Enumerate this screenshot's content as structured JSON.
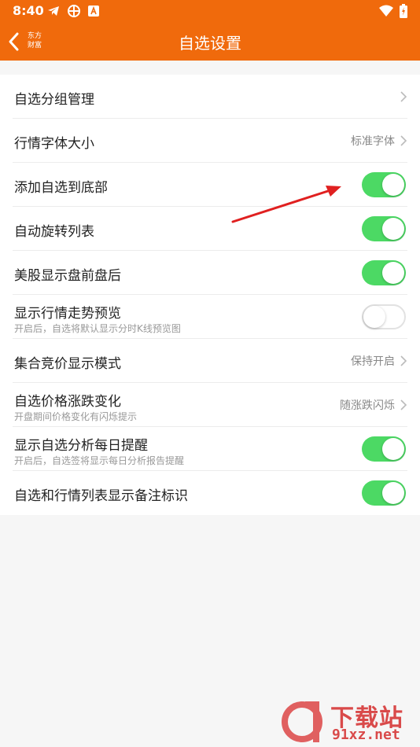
{
  "status_bar": {
    "time": "8:40",
    "left_icons": [
      "telegram-icon",
      "pinwheel-icon",
      "app-a-icon"
    ],
    "right_icons": [
      "wifi-icon",
      "battery-icon"
    ]
  },
  "header": {
    "title": "自选设置",
    "brand_line1": "东方",
    "brand_line2": "财富",
    "background": "#f06a0c"
  },
  "rows": [
    {
      "title": "自选分组管理",
      "value": "",
      "control": "chevron"
    },
    {
      "title": "行情字体大小",
      "value": "标准字体",
      "control": "chevron"
    },
    {
      "title": "添加自选到底部",
      "value": "",
      "control": "toggle",
      "on": true
    },
    {
      "title": "自动旋转列表",
      "value": "",
      "control": "toggle",
      "on": true
    },
    {
      "title": "美股显示盘前盘后",
      "value": "",
      "control": "toggle",
      "on": true
    },
    {
      "title": "显示行情走势预览",
      "subtitle": "开启后，自选将默认显示分时K线预览图",
      "value": "",
      "control": "toggle",
      "on": false
    },
    {
      "title": "集合竞价显示模式",
      "value": "保持开启",
      "control": "chevron"
    },
    {
      "title": "自选价格涨跌变化",
      "subtitle": "开盘期间价格变化有闪烁提示",
      "value": "随涨跌闪烁",
      "control": "chevron"
    },
    {
      "title": "显示自选分析每日提醒",
      "subtitle": "开启后，自选签将显示每日分析报告提醒",
      "value": "",
      "control": "toggle",
      "on": true
    },
    {
      "title": "自选和行情列表显示备注标识",
      "value": "",
      "control": "toggle",
      "on": true
    }
  ],
  "colors": {
    "accent": "#f06a0c",
    "toggle_on": "#4cd964",
    "annotation_arrow": "#e02020"
  },
  "watermark": {
    "title": "下载站",
    "url": "91xz.net"
  }
}
